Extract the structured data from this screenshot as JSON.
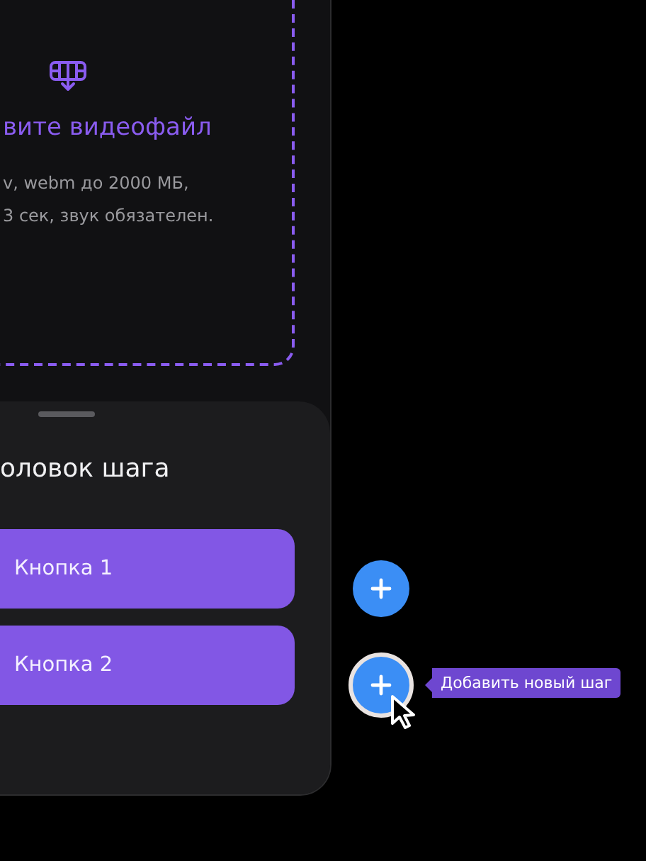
{
  "upload": {
    "title": "вите видеофайл",
    "description": [
      "v, webm до 2000 МБ,",
      "3 сек, звук обязателен."
    ]
  },
  "step_sheet": {
    "title": "оловок шага",
    "buttons": [
      "Кнопка 1",
      "Кнопка 2"
    ]
  },
  "add_step_buttons": [
    {
      "focused": false
    },
    {
      "focused": true,
      "tooltip": "Добавить новый шаг"
    }
  ]
}
